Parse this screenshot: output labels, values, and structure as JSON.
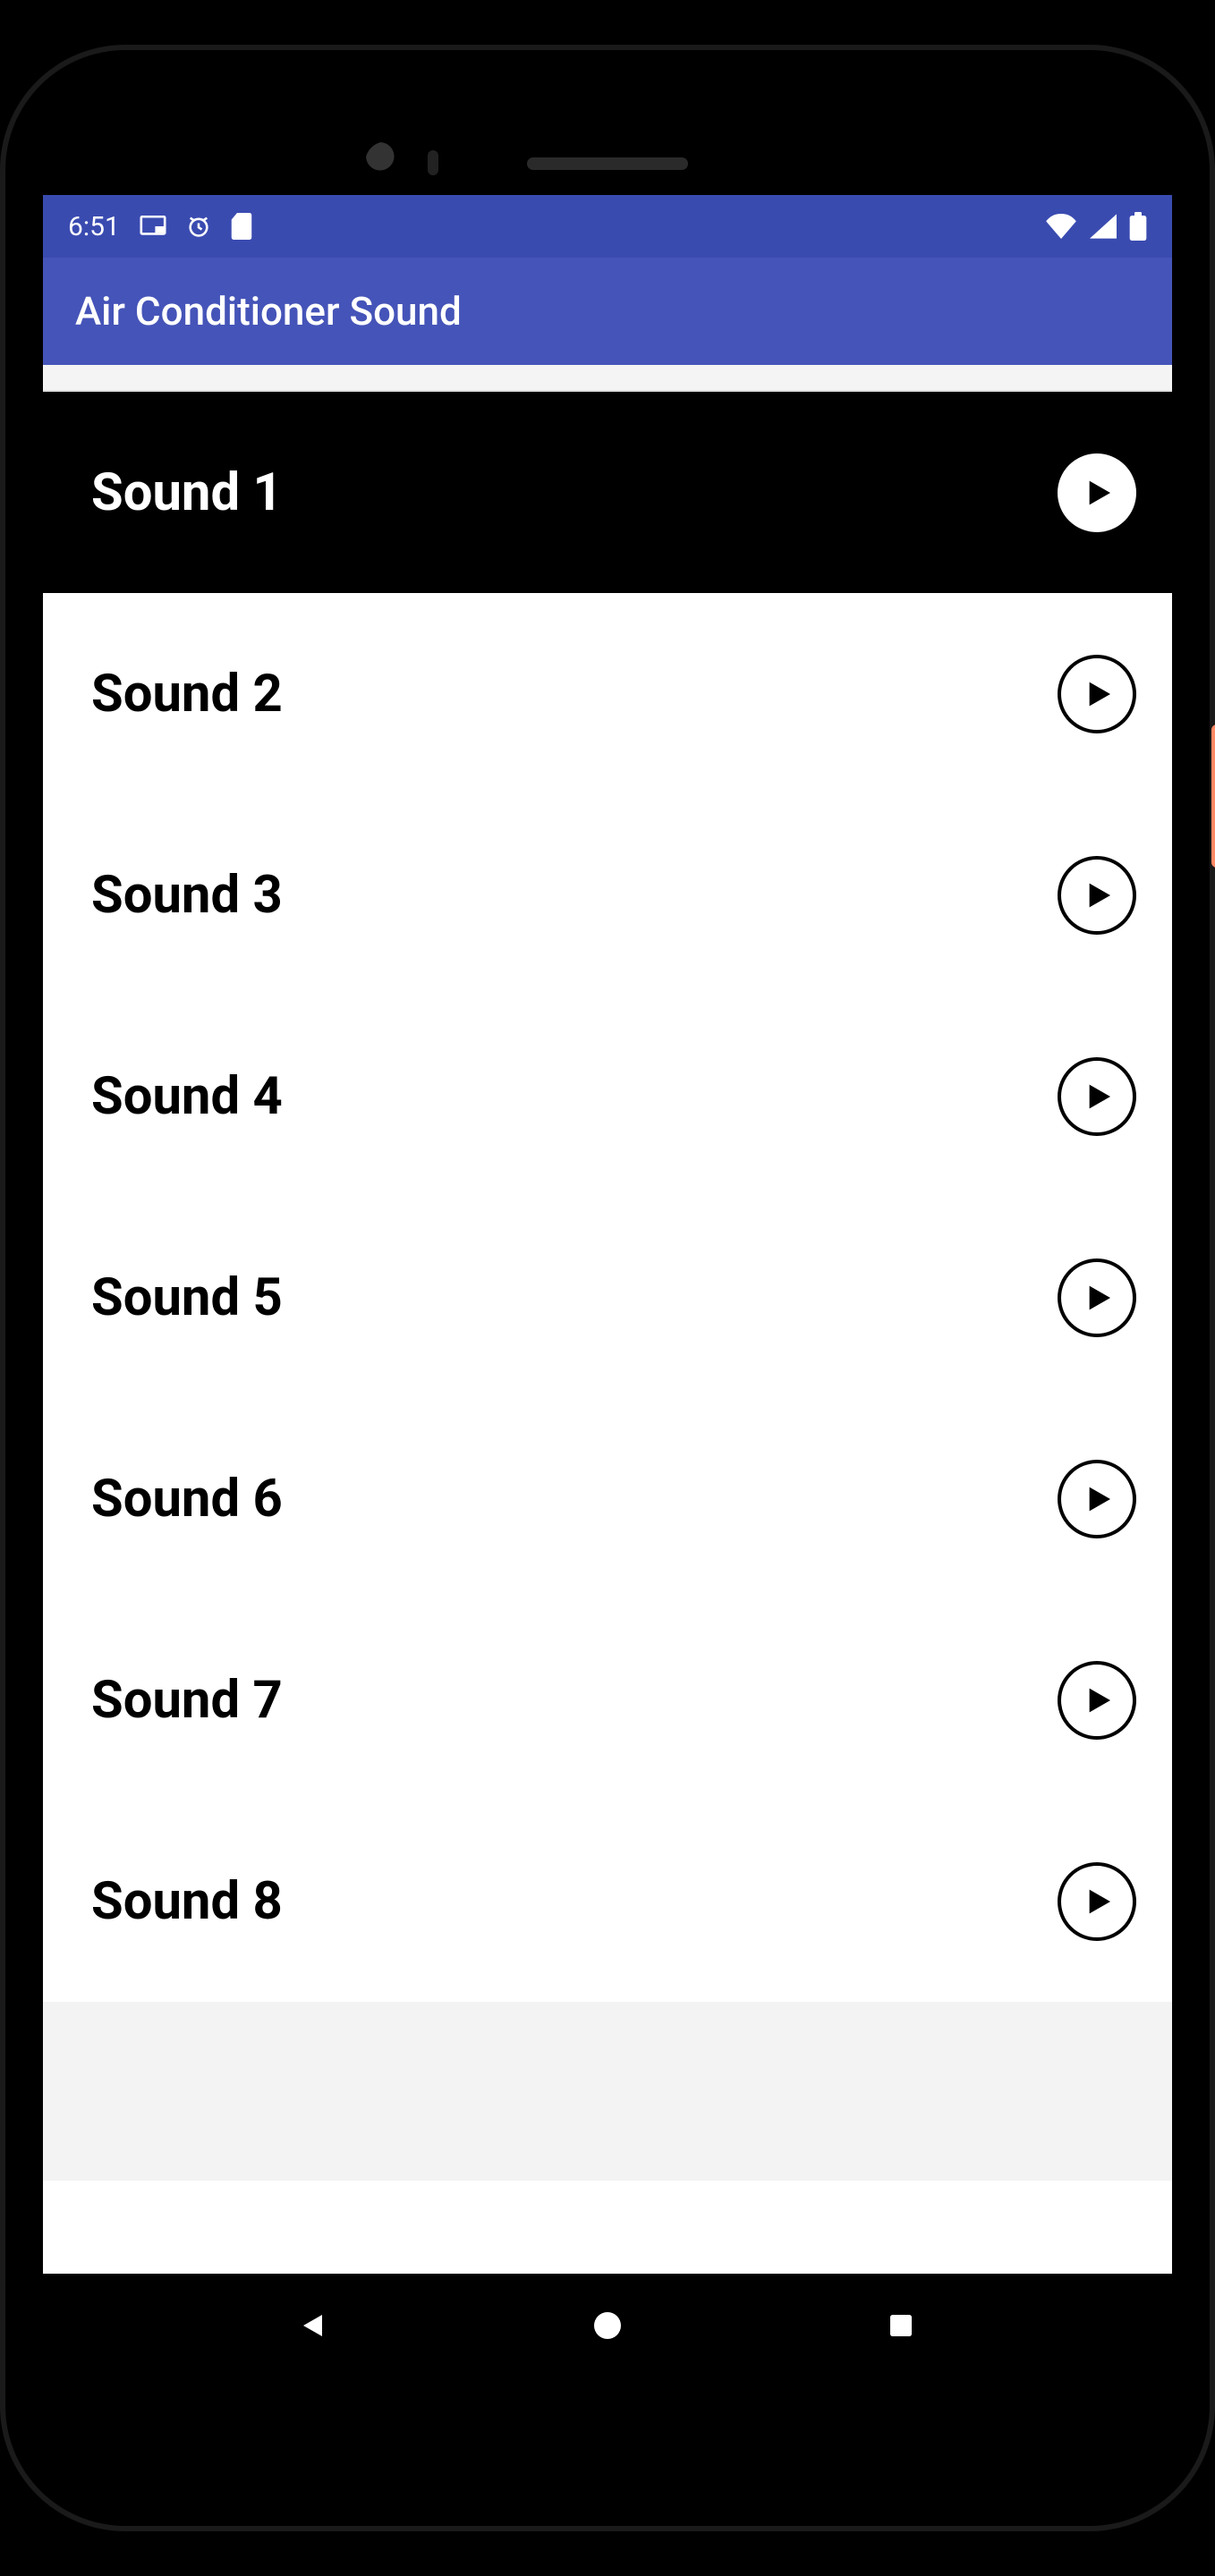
{
  "status": {
    "time": "6:51"
  },
  "app": {
    "title": "Air Conditioner Sound"
  },
  "sounds": [
    {
      "label": "Sound 1",
      "selected": true
    },
    {
      "label": "Sound 2",
      "selected": false
    },
    {
      "label": "Sound 3",
      "selected": false
    },
    {
      "label": "Sound 4",
      "selected": false
    },
    {
      "label": "Sound 5",
      "selected": false
    },
    {
      "label": "Sound 6",
      "selected": false
    },
    {
      "label": "Sound 7",
      "selected": false
    },
    {
      "label": "Sound 8",
      "selected": false
    }
  ]
}
